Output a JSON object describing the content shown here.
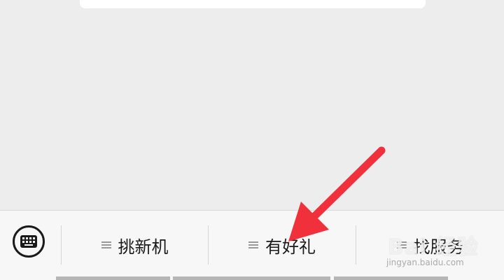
{
  "menu": {
    "items": [
      {
        "label": "挑新机",
        "icon": "hamburger-icon"
      },
      {
        "label": "有好礼",
        "icon": "hamburger-icon"
      },
      {
        "label": "找服务",
        "icon": "hamburger-icon"
      }
    ],
    "keyboard_icon": "keyboard-icon"
  },
  "watermark": {
    "main": "Bai 经验",
    "sub": "jingyan.baidu.com"
  },
  "annotation": {
    "arrow_color": "#f0313b",
    "icon": "red-arrow-icon"
  }
}
